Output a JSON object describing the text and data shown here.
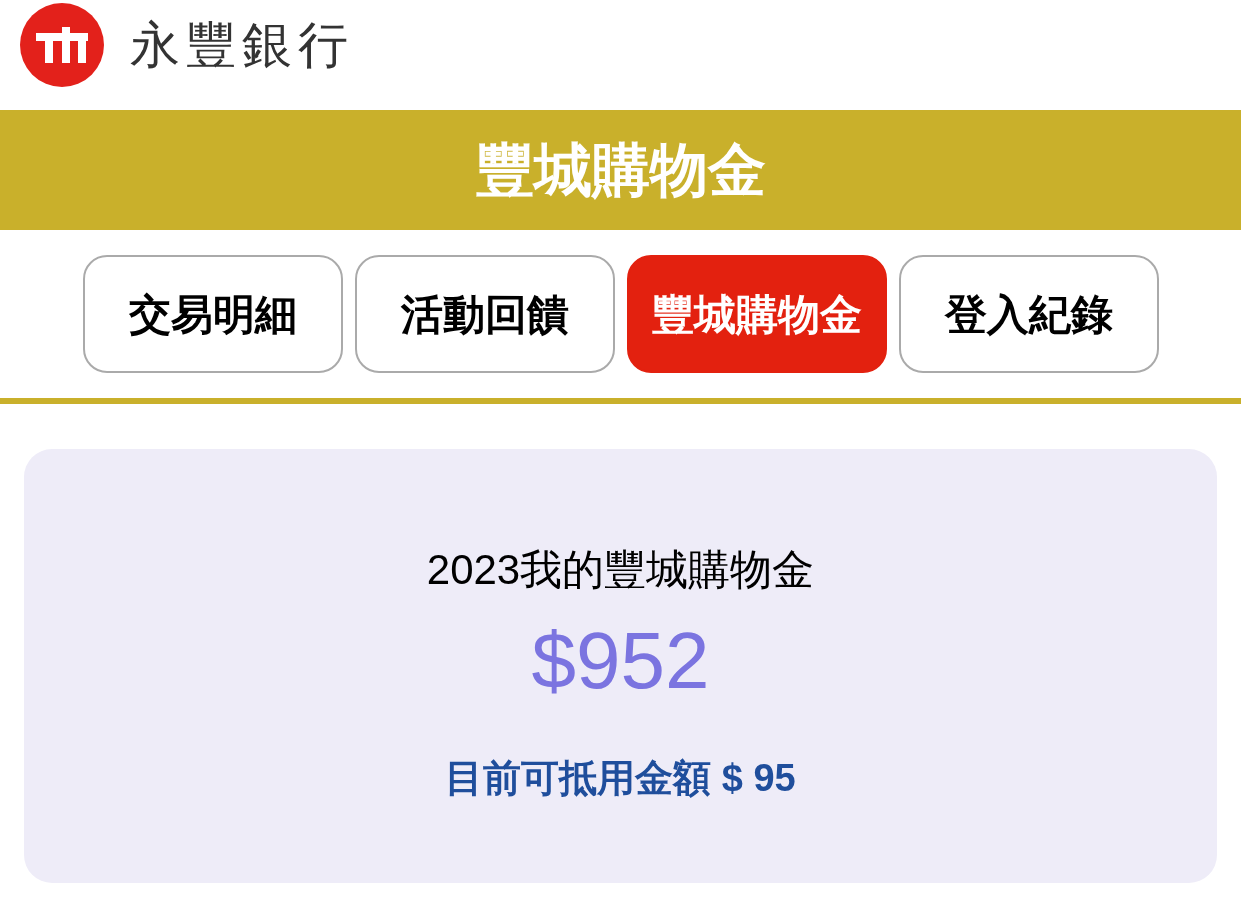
{
  "header": {
    "bank_name": "永豐銀行"
  },
  "banner": {
    "title": "豐城購物金"
  },
  "tabs": [
    {
      "label": "交易明細",
      "selected": false
    },
    {
      "label": "活動回饋",
      "selected": false
    },
    {
      "label": "豐城購物金",
      "selected": true
    },
    {
      "label": "登入紀錄",
      "selected": false
    }
  ],
  "card": {
    "title": "2023我的豐城購物金",
    "amount": "$952",
    "available": "目前可抵用金額 $ 95"
  }
}
